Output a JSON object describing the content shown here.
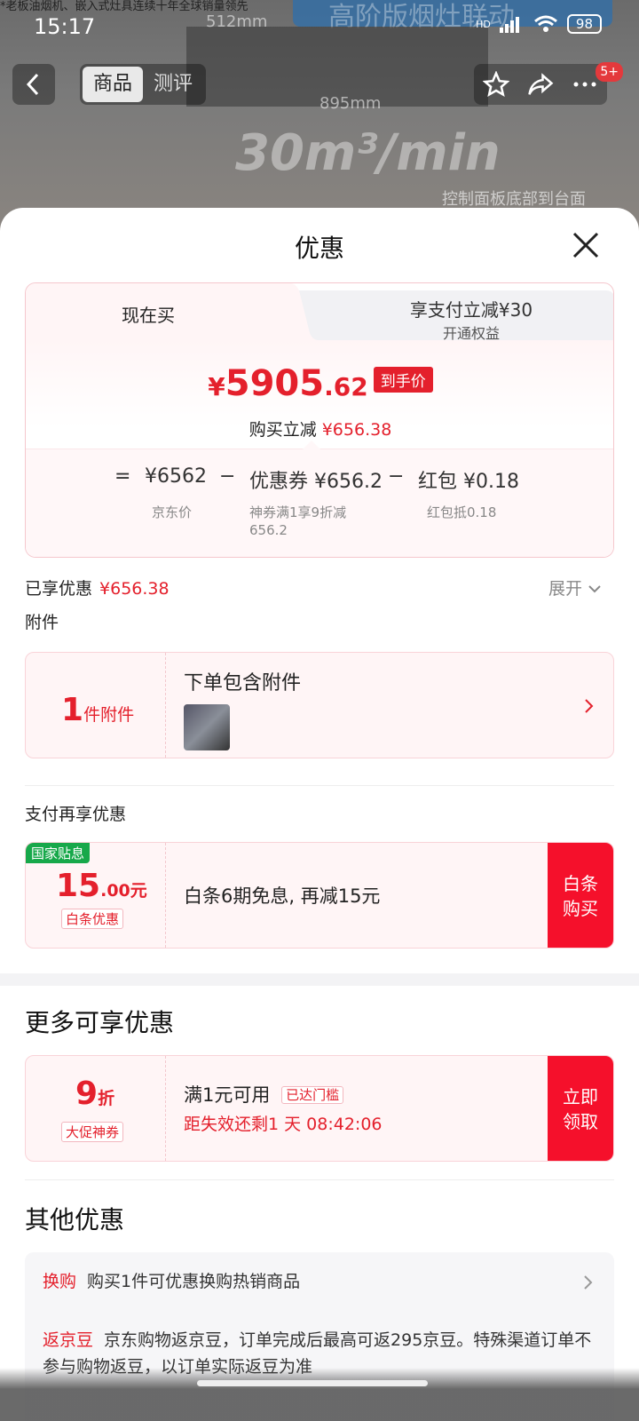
{
  "background": {
    "banner_text": "高阶版烟灶联动",
    "top_caption": "*老板油烟机、嵌入式灶具连续十年全球销量领先",
    "dim_top": "512mm",
    "dim_width": "895mm",
    "airflow": "30m³/min",
    "panel_caption": "控制面板底部到台面"
  },
  "status": {
    "time": "15:17",
    "network": "HD",
    "battery": "98"
  },
  "nav": {
    "tabs": [
      {
        "label": "商品"
      },
      {
        "label": "测评"
      }
    ],
    "badge": "5+"
  },
  "sheet": {
    "title": "优惠",
    "price_card": {
      "tab_now": "现在买",
      "tab_pay_line1": "享支付立减¥30",
      "tab_pay_line2": "开通权益",
      "final_price_yen": "¥",
      "final_price_int": "5905",
      "final_price_dec": ".62",
      "final_price_tag": "到手价",
      "reduce_label": "购买立减",
      "reduce_value": "¥656.38",
      "breakdown": {
        "eq": "=",
        "jd_price": "¥6562",
        "jd_price_label": "京东价",
        "minus1": "−",
        "coupon": "优惠券 ¥656.2",
        "coupon_desc_line1": "神券满1享9折减",
        "coupon_desc_line2": "656.2",
        "minus2": "−",
        "redpack": "红包 ¥0.18",
        "redpack_desc": "红包抵0.18"
      }
    },
    "enjoyed_label": "已享优惠",
    "enjoyed_value": "¥656.38",
    "expand_label": "展开",
    "attachments": {
      "section": "附件",
      "count": "1",
      "count_unit": "件附件",
      "title": "下单包含附件"
    },
    "pay_more": {
      "section": "支付再享优惠",
      "badge": "国家贴息",
      "amount_int": "15",
      "amount_dec": ".00元",
      "type_tag": "白条优惠",
      "desc": "白条6期免息, 再减15元",
      "btn_line1": "白条",
      "btn_line2": "购买"
    },
    "more": {
      "heading": "更多可享优惠",
      "discount": "9",
      "discount_unit": "折",
      "type_tag": "大促神券",
      "title": "满1元可用",
      "status_tag": "已达门槛",
      "countdown": "距失效还剩1 天 08:42:06",
      "btn_line1": "立即",
      "btn_line2": "领取"
    },
    "other": {
      "heading": "其他优惠",
      "rows": [
        {
          "tag": "换购",
          "text": "购买1件可优惠换购热销商品"
        },
        {
          "tag": "返京豆",
          "text": "京东购物返京豆，订单完成后最高可返295京豆。特殊渠道订单不参与购物返豆，以订单实际返豆为准"
        }
      ]
    }
  },
  "colors": {
    "accent": "#e4202c",
    "button_red": "#f5102b",
    "pink_bg": "#fff5f6",
    "green_badge": "#17a84a"
  }
}
